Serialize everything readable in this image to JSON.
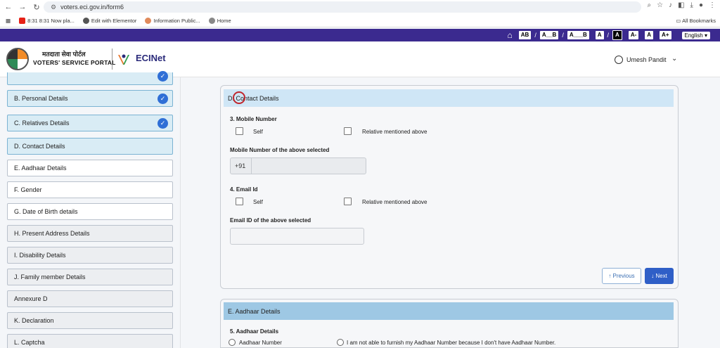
{
  "browser": {
    "url": "voters.eci.gov.in/form6",
    "bookmarks": [
      "8:31 8:31 Now pla...",
      "Edit with Elementor",
      "Information Public...",
      "Home"
    ],
    "all_bookmarks": "All Bookmarks"
  },
  "access_bar": {
    "items": [
      "AB",
      "A__B",
      "A___B",
      "A",
      "A",
      "A-",
      "A",
      "A+"
    ],
    "separators": [
      "/",
      "/",
      "/"
    ],
    "language": "English"
  },
  "header": {
    "portal_hindi": "मतदाता सेवा पोर्टल",
    "portal_english": "VOTERS' SERVICE PORTAL",
    "ecinet": "ECINet",
    "user_name": "Umesh Pandit"
  },
  "sidebar": {
    "items": [
      {
        "label": "B. Personal Details",
        "state": "done"
      },
      {
        "label": "C. Relatives Details",
        "state": "done"
      },
      {
        "label": "D. Contact Details",
        "state": "active"
      },
      {
        "label": "E. Aadhaar Details",
        "state": "pending"
      },
      {
        "label": "F. Gender",
        "state": "pending"
      },
      {
        "label": "G. Date of Birth details",
        "state": "pending"
      },
      {
        "label": "H. Present Address Details",
        "state": "locked"
      },
      {
        "label": "I. Disability Details",
        "state": "locked"
      },
      {
        "label": "J. Family member Details",
        "state": "locked"
      },
      {
        "label": "Annexure D",
        "state": "locked"
      },
      {
        "label": "K. Declaration",
        "state": "locked"
      },
      {
        "label": "L. Captcha",
        "state": "locked"
      }
    ]
  },
  "contact": {
    "title": "D. Contact Details",
    "mobile_label": "3. Mobile Number",
    "self_label": "Self",
    "relative_label": "Relative mentioned above",
    "mobile_selected_label": "Mobile Number of the above selected",
    "country_code": "+91",
    "email_label": "4. Email Id",
    "email_self_label": "Self",
    "email_relative_label": "Relative mentioned above",
    "email_selected_label": "Email ID of the above selected",
    "prev_label": "↑ Previous",
    "next_label": "↓ Next"
  },
  "aadhaar": {
    "title": "E. Aadhaar Details",
    "q_label": "5. Aadhaar Details",
    "opt1": "Aadhaar Number",
    "opt2": "I am not able to furnish my Aadhaar Number because I don't have Aadhaar Number."
  }
}
